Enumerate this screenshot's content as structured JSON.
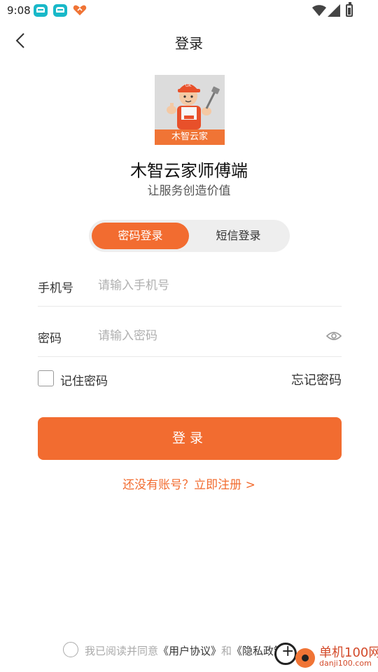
{
  "status_bar": {
    "time": "9:08",
    "notifications": [
      "car-app-icon",
      "car-app-icon",
      "heart-app-icon"
    ],
    "indicators": [
      "wifi-icon",
      "signal-icon",
      "battery-icon"
    ]
  },
  "nav": {
    "title": "登录",
    "back_icon": "chevron-left-icon"
  },
  "logo": {
    "banner_text": "木智云家"
  },
  "app": {
    "name": "木智云家师傅端",
    "slogan": "让服务创造价值"
  },
  "tabs": [
    {
      "label": "密码登录",
      "active": true
    },
    {
      "label": "短信登录",
      "active": false
    }
  ],
  "form": {
    "phone_label": "手机号",
    "phone_placeholder": "请输入手机号",
    "password_label": "密码",
    "password_placeholder": "请输入密码",
    "remember_label": "记住密码",
    "forgot_label": "忘记密码",
    "login_label": "登录"
  },
  "register": {
    "text": "还没有账号？立即注册 >"
  },
  "agreement": {
    "prefix": "我已阅读并同意",
    "user_agreement": "《用户协议》",
    "and": "和",
    "privacy_policy": "《隐私政策》"
  },
  "watermark": {
    "text": "单机100网",
    "url": "danji100.com"
  },
  "colors": {
    "accent": "#f26c30",
    "tab_bg": "#eeeeee",
    "placeholder": "#b0b0b0",
    "divider": "#e8e8e8"
  }
}
